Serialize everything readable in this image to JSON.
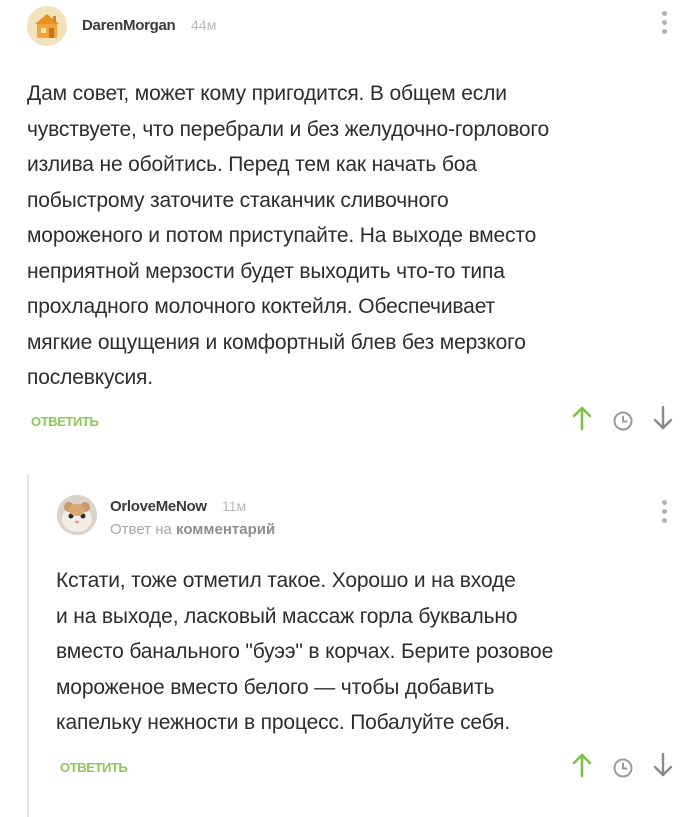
{
  "comments": [
    {
      "username": "DarenMorgan",
      "time": "44м",
      "text": "Дам совет, может кому пригодится. В общем если\nчувствуете, что перебрали и без желудочно-горлового\nизлива не обойтись. Перед тем как начать боа\nпобыстрому заточите стаканчик сливочного\nмороженого и потом приступайте. На выходе вместо\nнеприятной мерзости будет выходить что-то типа\nпрохладного молочного коктейля. Обеспечивает\nмягкие ощущения и комфортный блев без мерзкого\nпослевкусия.",
      "reply_label": "ответить",
      "avatar_icon": "avatar-orange-house-icon"
    },
    {
      "username": "OrloveMeNow",
      "time": "11м",
      "reply_prefix": "Ответ на",
      "reply_target": "комментарий",
      "text": "Кстати, тоже отметил такое. Хорошо и на входе\nи на выходе, ласковый массаж горла буквально\nвместо банального \"буээ\" в корчах. Берите розовое\nмороженое вместо белого — чтобы добавить\nкапельку нежности в процесс. Побалуйте себя.",
      "reply_label": "ответить",
      "avatar_icon": "avatar-hamster-icon"
    }
  ],
  "colors": {
    "accent_green": "#8ac858",
    "text": "#2d2d2d",
    "muted": "#b3b3b3"
  },
  "icons": {
    "upvote": "arrow-up-icon",
    "save": "clock-icon",
    "downvote": "arrow-down-icon",
    "menu": "more-vertical-icon"
  }
}
